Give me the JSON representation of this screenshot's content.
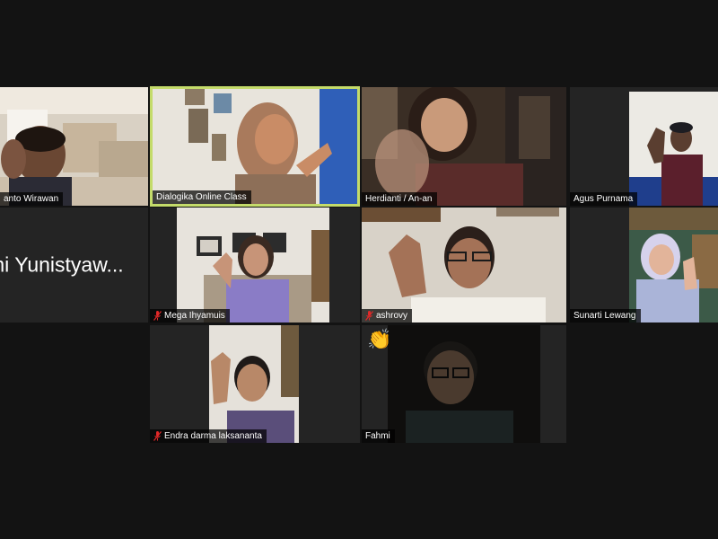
{
  "meeting": {
    "view": "gallery",
    "colors": {
      "background": "#131313",
      "tile": "#242424",
      "active_speaker": "#c4db6a",
      "muted_mic": "#e02828"
    },
    "participants": [
      {
        "name": "anto Wirawan",
        "muted": false
      },
      {
        "name": "Dialogika Online Class",
        "muted": false,
        "active_speaker": true
      },
      {
        "name": "Herdianti / An-an",
        "muted": false
      },
      {
        "name": "Agus Purnama",
        "muted": false
      },
      {
        "name": "mi Yunistyaw...",
        "muted": false,
        "video_off": true
      },
      {
        "name": "Mega Ihyamuis",
        "muted": true
      },
      {
        "name": "ashrovy",
        "muted": true
      },
      {
        "name": "Sunarti Lewang",
        "muted": false
      },
      {
        "name": "Endra darma laksananta",
        "muted": true
      },
      {
        "name": "Fahmi",
        "muted": false,
        "reaction": "👏",
        "reaction_icon": "clapping-hands-icon"
      }
    ]
  }
}
